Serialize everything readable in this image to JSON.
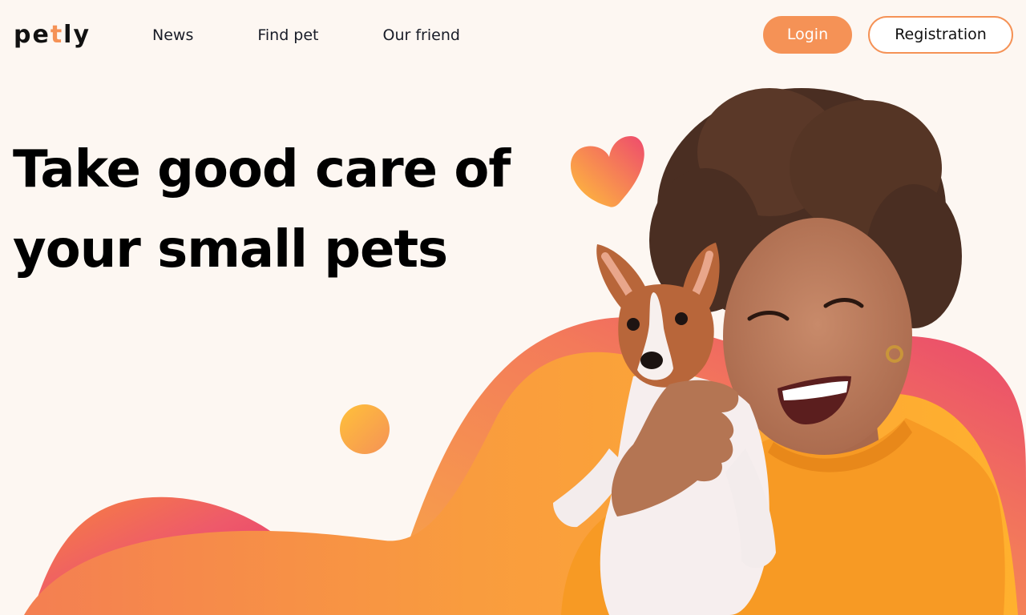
{
  "header": {
    "logo": {
      "part1": "pe",
      "accent": "t",
      "part2": "ly"
    },
    "nav": [
      {
        "label": "News"
      },
      {
        "label": "Find pet"
      },
      {
        "label": "Our friend"
      }
    ],
    "auth": {
      "login_label": "Login",
      "register_label": "Registration"
    }
  },
  "hero": {
    "title_line1": "Take good care of",
    "title_line2": "your small pets"
  },
  "colors": {
    "accent": "#F59256",
    "background": "#FDF7F2",
    "wave_pink": "#EE4B6D",
    "wave_orange": "#FFB12E",
    "text": "#111111"
  },
  "icons": {
    "heart": "heart-icon",
    "dot": "decor-circle"
  }
}
